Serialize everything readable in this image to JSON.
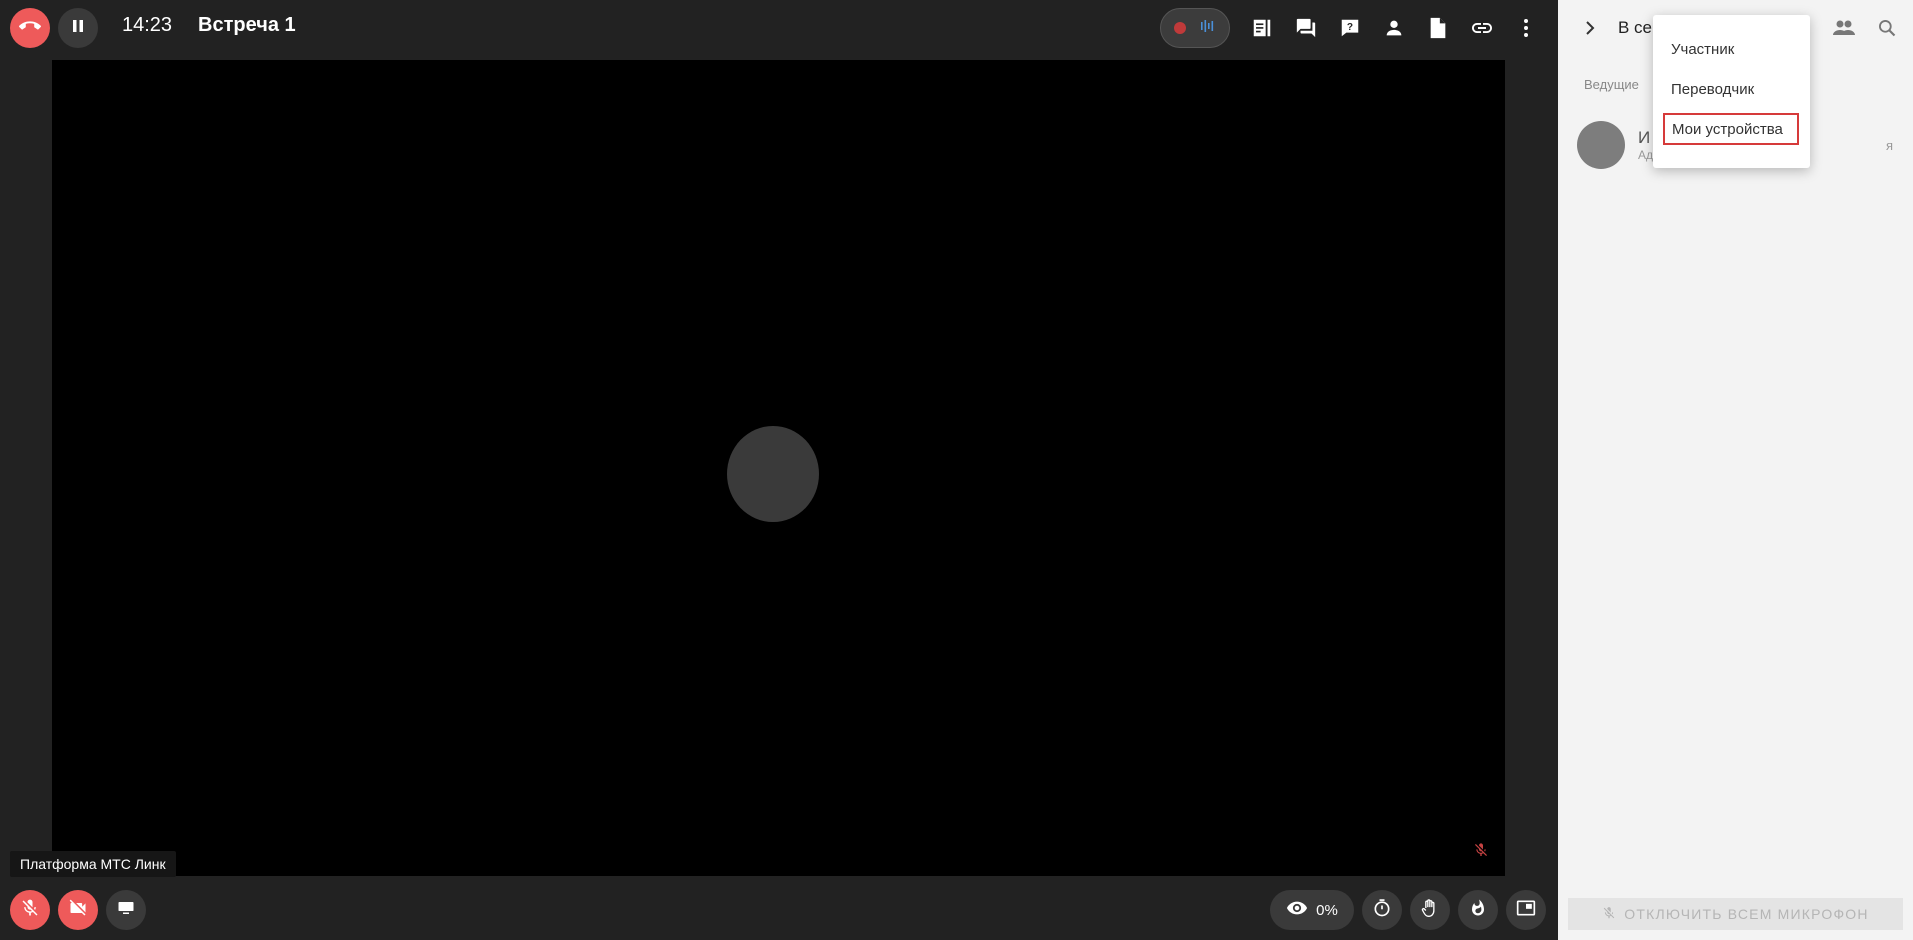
{
  "topbar": {
    "time": "14:23",
    "title": "Встреча 1"
  },
  "video": {
    "platform_label": "Платформа МТС Линк"
  },
  "bottombar": {
    "views_percent": "0%"
  },
  "panel": {
    "title": "В се",
    "section_hosts": "Ведущие",
    "participant": {
      "name": "И",
      "role": "Ад",
      "me_label": "я"
    },
    "mute_all_label": "Отключить всем микрофон"
  },
  "dropdown": {
    "items": [
      "Участник",
      "Переводчик",
      "Мои устройства"
    ],
    "highlighted": "Мои устройства"
  },
  "colors": {
    "danger": "#ee5a5a",
    "panel_bg": "#f3f3f3",
    "stage_bg": "#222222",
    "highlight_border": "#d63a3a"
  }
}
